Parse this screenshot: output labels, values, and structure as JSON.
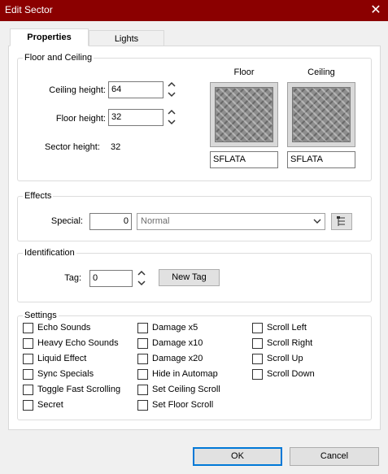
{
  "window": {
    "title": "Edit Sector",
    "close_glyph": "✕"
  },
  "tabs": [
    {
      "label": "Properties",
      "active": true
    },
    {
      "label": "Lights",
      "active": false
    }
  ],
  "floor_ceiling": {
    "group_label": "Floor and Ceiling",
    "ceiling_height_label": "Ceiling height:",
    "ceiling_height": "64",
    "floor_height_label": "Floor height:",
    "floor_height": "32",
    "sector_height_label": "Sector height:",
    "sector_height": "32",
    "floor_label": "Floor",
    "ceiling_label": "Ceiling",
    "floor_texture": "SFLATA",
    "ceiling_texture": "SFLATA"
  },
  "effects": {
    "group_label": "Effects",
    "special_label": "Special:",
    "special_value": "0",
    "special_selected": "Normal",
    "browse_icon": "tree-browse-icon"
  },
  "identification": {
    "group_label": "Identification",
    "tag_label": "Tag:",
    "tag_value": "0",
    "new_tag_label": "New Tag"
  },
  "settings": {
    "group_label": "Settings",
    "columns": [
      [
        "Echo Sounds",
        "Heavy Echo Sounds",
        "Liquid Effect",
        "Sync Specials",
        "Toggle Fast Scrolling",
        "Secret"
      ],
      [
        "Damage x5",
        "Damage x10",
        "Damage x20",
        "Hide in Automap",
        "Set Ceiling Scroll",
        "Set Floor Scroll"
      ],
      [
        "Scroll Left",
        "Scroll Right",
        "Scroll Up",
        "Scroll Down"
      ]
    ]
  },
  "buttons": {
    "ok": "OK",
    "cancel": "Cancel"
  },
  "colors": {
    "titlebar": "#8b0000",
    "default_button_border": "#0078d7"
  }
}
